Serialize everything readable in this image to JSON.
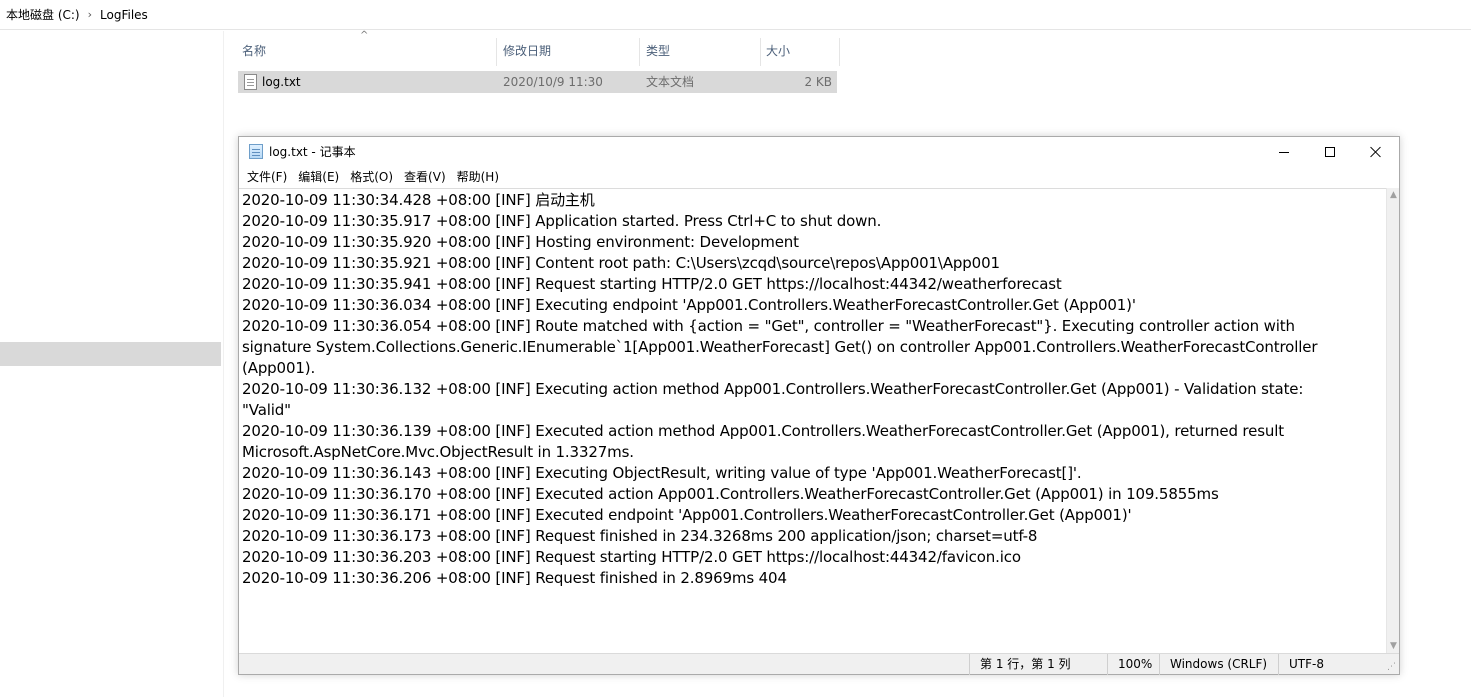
{
  "explorer": {
    "breadcrumb": [
      "本地磁盘 (C:)",
      "LogFiles"
    ],
    "columns": {
      "name": "名称",
      "date": "修改日期",
      "type": "类型",
      "size": "大小"
    },
    "file": {
      "name": "log.txt",
      "date": "2020/10/9 11:30",
      "type": "文本文档",
      "size": "2 KB"
    }
  },
  "notepad": {
    "title": "log.txt - 记事本",
    "menu": [
      "文件(F)",
      "编辑(E)",
      "格式(O)",
      "查看(V)",
      "帮助(H)"
    ],
    "lines": [
      "2020-10-09 11:30:34.428 +08:00 [INF] 启动主机",
      "2020-10-09 11:30:35.917 +08:00 [INF] Application started. Press Ctrl+C to shut down.",
      "2020-10-09 11:30:35.920 +08:00 [INF] Hosting environment: Development",
      "2020-10-09 11:30:35.921 +08:00 [INF] Content root path: C:\\Users\\zcqd\\source\\repos\\App001\\App001",
      "2020-10-09 11:30:35.941 +08:00 [INF] Request starting HTTP/2.0 GET https://localhost:44342/weatherforecast",
      "2020-10-09 11:30:36.034 +08:00 [INF] Executing endpoint 'App001.Controllers.WeatherForecastController.Get (App001)'",
      "2020-10-09 11:30:36.054 +08:00 [INF] Route matched with {action = \"Get\", controller = \"WeatherForecast\"}. Executing controller action with",
      "signature System.Collections.Generic.IEnumerable`1[App001.WeatherForecast] Get() on controller App001.Controllers.WeatherForecastController",
      "(App001).",
      "2020-10-09 11:30:36.132 +08:00 [INF] Executing action method App001.Controllers.WeatherForecastController.Get (App001) - Validation state:",
      "\"Valid\"",
      "2020-10-09 11:30:36.139 +08:00 [INF] Executed action method App001.Controllers.WeatherForecastController.Get (App001), returned result",
      "Microsoft.AspNetCore.Mvc.ObjectResult in 1.3327ms.",
      "2020-10-09 11:30:36.143 +08:00 [INF] Executing ObjectResult, writing value of type 'App001.WeatherForecast[]'.",
      "2020-10-09 11:30:36.170 +08:00 [INF] Executed action App001.Controllers.WeatherForecastController.Get (App001) in 109.5855ms",
      "2020-10-09 11:30:36.171 +08:00 [INF] Executed endpoint 'App001.Controllers.WeatherForecastController.Get (App001)'",
      "2020-10-09 11:30:36.173 +08:00 [INF] Request finished in 234.3268ms 200 application/json; charset=utf-8",
      "2020-10-09 11:30:36.203 +08:00 [INF] Request starting HTTP/2.0 GET https://localhost:44342/favicon.ico",
      "2020-10-09 11:30:36.206 +08:00 [INF] Request finished in 2.8969ms 404"
    ],
    "status": {
      "position": "第 1 行，第 1 列",
      "zoom": "100%",
      "line_ending": "Windows (CRLF)",
      "encoding": "UTF-8"
    }
  }
}
